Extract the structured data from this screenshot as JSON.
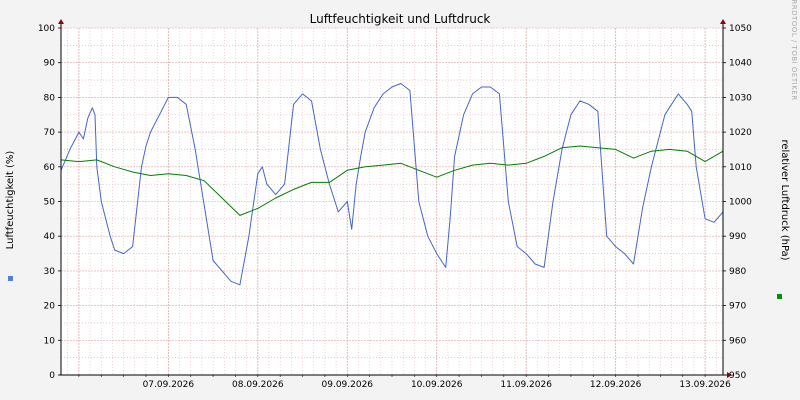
{
  "chart_data": {
    "type": "line",
    "title": "Luftfeuchtigkeit und Luftdruck",
    "watermark": "RRDTOOL / TOBI OETIKER",
    "ylabel_left": "Luftfeuchtigkeit (%)",
    "ylabel_right": "relativer Luftdruck (hPa)",
    "ylim_left": [
      0,
      100
    ],
    "ylim_right": [
      950,
      1050
    ],
    "yticks_left": [
      "0",
      "10",
      "20",
      "30",
      "40",
      "50",
      "60",
      "70",
      "80",
      "90",
      "100"
    ],
    "yticks_right": [
      "950",
      "960",
      "970",
      "980",
      "990",
      "1000",
      "1010",
      "1020",
      "1030",
      "1040",
      "1050"
    ],
    "x_range_days": [
      6.3,
      13.7
    ],
    "x_tick_labels": [
      {
        "day": 7.5,
        "label": "07.09.2026"
      },
      {
        "day": 8.5,
        "label": "08.09.2026"
      },
      {
        "day": 9.5,
        "label": "09.09.2026"
      },
      {
        "day": 10.5,
        "label": "10.09.2026"
      },
      {
        "day": 11.5,
        "label": "11.09.2026"
      },
      {
        "day": 12.5,
        "label": "12.09.2026"
      },
      {
        "day": 13.5,
        "label": "13.09.2026"
      }
    ],
    "grid": true,
    "colors": {
      "humidity": "#4466cc",
      "pressure": "#008000",
      "grid": "#e0a8a8",
      "axis": "#000000",
      "arrow": "#990000",
      "legend_humidity": "#4f7fe0",
      "legend_pressure": "#009000"
    },
    "series": [
      {
        "key": "humidity",
        "axis": "left",
        "x": [
          6.3,
          6.35,
          6.4,
          6.5,
          6.55,
          6.6,
          6.65,
          6.68,
          6.7,
          6.75,
          6.8,
          6.85,
          6.9,
          7.0,
          7.1,
          7.2,
          7.25,
          7.3,
          7.4,
          7.5,
          7.6,
          7.7,
          7.8,
          8.0,
          8.2,
          8.3,
          8.4,
          8.5,
          8.55,
          8.6,
          8.7,
          8.8,
          8.9,
          9.0,
          9.05,
          9.1,
          9.2,
          9.3,
          9.4,
          9.5,
          9.55,
          9.6,
          9.65,
          9.7,
          9.8,
          9.9,
          10.0,
          10.1,
          10.2,
          10.3,
          10.4,
          10.5,
          10.55,
          10.6,
          10.65,
          10.7,
          10.8,
          10.9,
          11.0,
          11.1,
          11.2,
          11.3,
          11.4,
          11.5,
          11.6,
          11.7,
          11.8,
          11.9,
          12.0,
          12.1,
          12.2,
          12.3,
          12.4,
          12.5,
          12.6,
          12.7,
          12.8,
          12.9,
          13.0,
          13.05,
          13.1,
          13.2,
          13.3,
          13.35,
          13.4,
          13.5,
          13.6,
          13.7
        ],
        "y": [
          59,
          62,
          65,
          70,
          68,
          74,
          77,
          75,
          60,
          50,
          45,
          40,
          36,
          35,
          37,
          60,
          66,
          70,
          75,
          80,
          80,
          78,
          65,
          33,
          27,
          26,
          40,
          58,
          60,
          55,
          52,
          55,
          78,
          81,
          80,
          79,
          65,
          55,
          47,
          50,
          42,
          55,
          63,
          70,
          77,
          81,
          83,
          84,
          82,
          50,
          40,
          35,
          33,
          31,
          45,
          63,
          75,
          81,
          83,
          83,
          81,
          50,
          37,
          35,
          32,
          31,
          50,
          65,
          75,
          79,
          78,
          76,
          40,
          37,
          35,
          32,
          48,
          60,
          70,
          75,
          77,
          81,
          78,
          76,
          60,
          45,
          44,
          47
        ]
      },
      {
        "key": "pressure",
        "axis": "right",
        "x": [
          6.3,
          6.5,
          6.7,
          6.9,
          7.1,
          7.3,
          7.5,
          7.7,
          7.9,
          8.1,
          8.3,
          8.5,
          8.7,
          8.9,
          9.1,
          9.3,
          9.5,
          9.7,
          9.9,
          10.1,
          10.3,
          10.5,
          10.7,
          10.9,
          11.1,
          11.3,
          11.5,
          11.7,
          11.9,
          12.1,
          12.3,
          12.5,
          12.7,
          12.9,
          13.1,
          13.3,
          13.5,
          13.7
        ],
        "y": [
          1012,
          1011.5,
          1012,
          1010,
          1008.5,
          1007.5,
          1008,
          1007.5,
          1006,
          1001,
          996,
          998,
          1001,
          1003.5,
          1005.5,
          1005.5,
          1009,
          1010,
          1010.5,
          1011,
          1009,
          1007,
          1009,
          1010.5,
          1011,
          1010.5,
          1011,
          1013,
          1015.5,
          1016,
          1015.5,
          1015,
          1012.5,
          1014.5,
          1015,
          1014.5,
          1011.5,
          1014.5
        ]
      }
    ]
  }
}
